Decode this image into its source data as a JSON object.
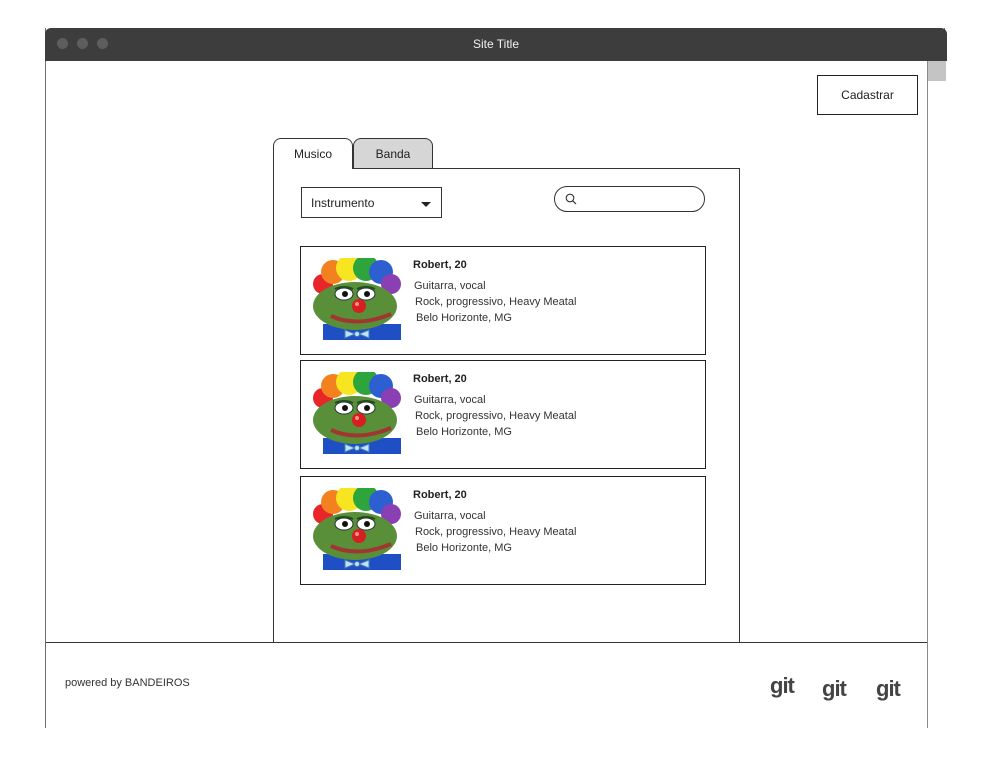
{
  "window": {
    "title": "Site Title"
  },
  "header": {
    "register_button": "Cadastrar"
  },
  "tabs": [
    {
      "label": "Musico",
      "active": true
    },
    {
      "label": "Banda",
      "active": false
    }
  ],
  "filters": {
    "instrument_select": "Instrumento",
    "search_placeholder": ""
  },
  "results": [
    {
      "name": "Robert, 20",
      "instruments": "Guitarra, vocal",
      "genres": "Rock, progressivo, Heavy Meatal",
      "location": "Belo Horizonte, MG",
      "avatar_icon": "clown-frog-avatar"
    },
    {
      "name": "Robert, 20",
      "instruments": "Guitarra, vocal",
      "genres": "Rock, progressivo, Heavy Meatal",
      "location": "Belo Horizonte, MG",
      "avatar_icon": "clown-frog-avatar"
    },
    {
      "name": "Robert, 20",
      "instruments": "Guitarra, vocal",
      "genres": "Rock, progressivo, Heavy Meatal",
      "location": "Belo Horizonte, MG",
      "avatar_icon": "clown-frog-avatar"
    }
  ],
  "footer": {
    "powered_by": "powered by BANDEIROS",
    "links": [
      "git",
      "git",
      "git"
    ]
  },
  "colors": {
    "titlebar": "#3d3d3d",
    "active_tab": "#ffffff",
    "inactive_tab": "#d6d6d6"
  }
}
